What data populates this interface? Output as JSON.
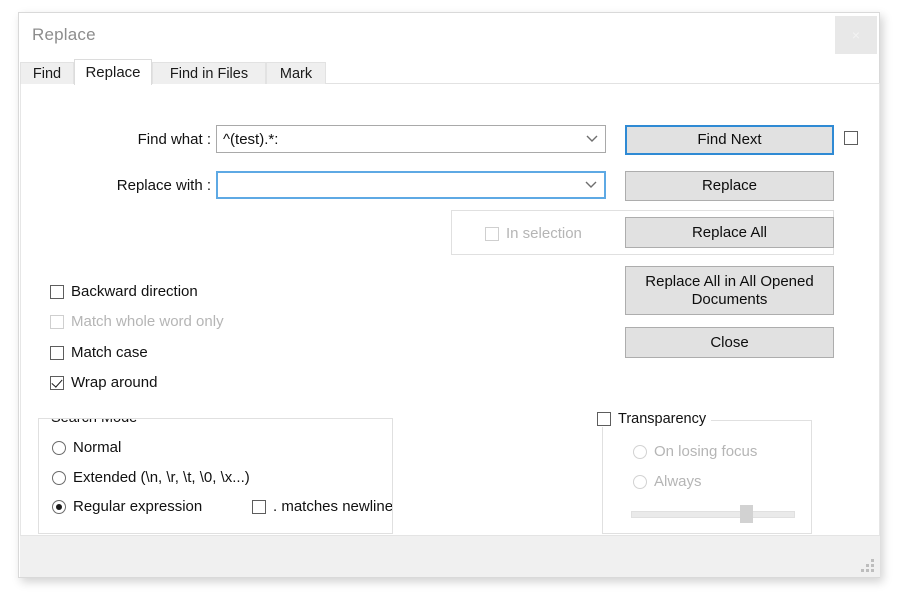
{
  "window": {
    "title": "Replace",
    "close_label": "×"
  },
  "tabs": [
    {
      "label": "Find",
      "active": false
    },
    {
      "label": "Replace",
      "active": true
    },
    {
      "label": "Find in Files",
      "active": false
    },
    {
      "label": "Mark",
      "active": false
    }
  ],
  "fields": {
    "find_what_label": "Find what :",
    "find_what_value": "^(test).*:",
    "replace_with_label": "Replace with :",
    "replace_with_value": "",
    "chevron": "⌄"
  },
  "buttons": {
    "find_next": "Find Next",
    "replace": "Replace",
    "replace_all": "Replace All",
    "replace_all_opened": "Replace All in All Opened Documents",
    "close": "Close"
  },
  "in_selection": {
    "label": "In selection",
    "checked": false,
    "enabled": false
  },
  "options": [
    {
      "label": "Backward direction",
      "checked": false,
      "enabled": true
    },
    {
      "label": "Match whole word only",
      "checked": false,
      "enabled": false
    },
    {
      "label": "Match case",
      "checked": false,
      "enabled": true
    },
    {
      "label": "Wrap around",
      "checked": true,
      "enabled": true
    }
  ],
  "search_mode": {
    "title": "Search Mode",
    "options": [
      {
        "label": "Normal",
        "selected": false
      },
      {
        "label": "Extended (\\n, \\r, \\t, \\0, \\x...)",
        "selected": false
      },
      {
        "label": "Regular expression",
        "selected": true
      }
    ],
    "dot_matches_newline": {
      "label": ". matches newline",
      "checked": false
    }
  },
  "transparency": {
    "title": "Transparency",
    "checked": false,
    "options": [
      {
        "label": "On losing focus",
        "selected": false
      },
      {
        "label": "Always",
        "selected": false
      }
    ],
    "slider_percent": 70
  },
  "colors": {
    "focus_blue": "#5ea9e4",
    "default_button_blue": "#2f8ad4",
    "button_face": "#e1e1e1",
    "disabled_text": "#b5b5b5",
    "title_text": "#8d8d8d"
  }
}
